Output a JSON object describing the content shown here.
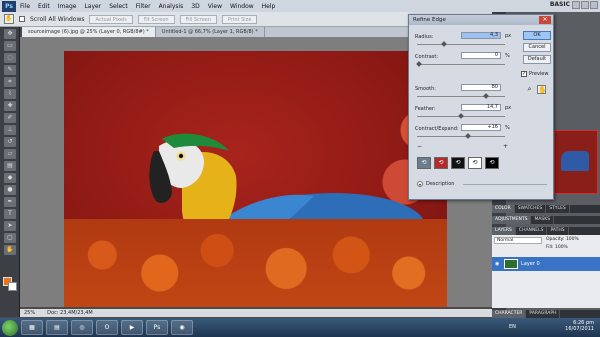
{
  "app": {
    "logo": "Ps",
    "menu": [
      "File",
      "Edit",
      "Image",
      "Layer",
      "Select",
      "Filter",
      "Analysis",
      "3D",
      "View",
      "Window",
      "Help"
    ],
    "workspace": "BASIC"
  },
  "options_bar": {
    "scroll_all_windows": "Scroll All Windows",
    "buttons": [
      "Actual Pixels",
      "Fit Screen",
      "Fill Screen",
      "Print Size"
    ]
  },
  "tabs": [
    "sourceimage (6).jpg @ 25% (Layer 0, RGB/8#) *",
    "Untitled-1 @ 66,7% (Layer 1, RGB/8) *"
  ],
  "status": {
    "zoom": "25%",
    "doc": "Doc: 23,4M/23,4M"
  },
  "dialog": {
    "title": "Refine Edge",
    "fields": [
      {
        "label": "Radius:",
        "value": "4,3",
        "unit": "px",
        "slider_pos": 0.3
      },
      {
        "label": "Contrast:",
        "value": "0",
        "unit": "%",
        "slider_pos": 0.0
      },
      {
        "label": "Smooth:",
        "value": "80",
        "unit": "",
        "slider_pos": 0.8
      },
      {
        "label": "Feather:",
        "value": "14,7",
        "unit": "px",
        "slider_pos": 0.5
      },
      {
        "label": "Contract/Expand:",
        "value": "+16",
        "unit": "%",
        "slider_pos": 0.58
      }
    ],
    "minus": "−",
    "plus": "+",
    "buttons": {
      "ok": "OK",
      "cancel": "Cancel",
      "default": "Default"
    },
    "preview_label": "Preview",
    "description_label": "Description"
  },
  "panels": {
    "top_tabs": [
      "COLOR",
      "SWATCHES",
      "STYLES"
    ],
    "mid_tabs": [
      "ADJUSTMENTS",
      "MASKS"
    ],
    "layer_tabs": [
      "LAYERS",
      "CHANNELS",
      "PATHS"
    ],
    "blend_mode": "Normal",
    "opacity_label": "Opacity:",
    "opacity_value": "100%",
    "fill_label": "Fill:",
    "fill_value": "100%",
    "layer_name": "Layer 0",
    "bottom_tabs": [
      "CHARACTER",
      "PARAGRAPH"
    ]
  },
  "taskbar": {
    "lang": "EN",
    "time": "6:26 pm",
    "date": "16/07/2011"
  }
}
